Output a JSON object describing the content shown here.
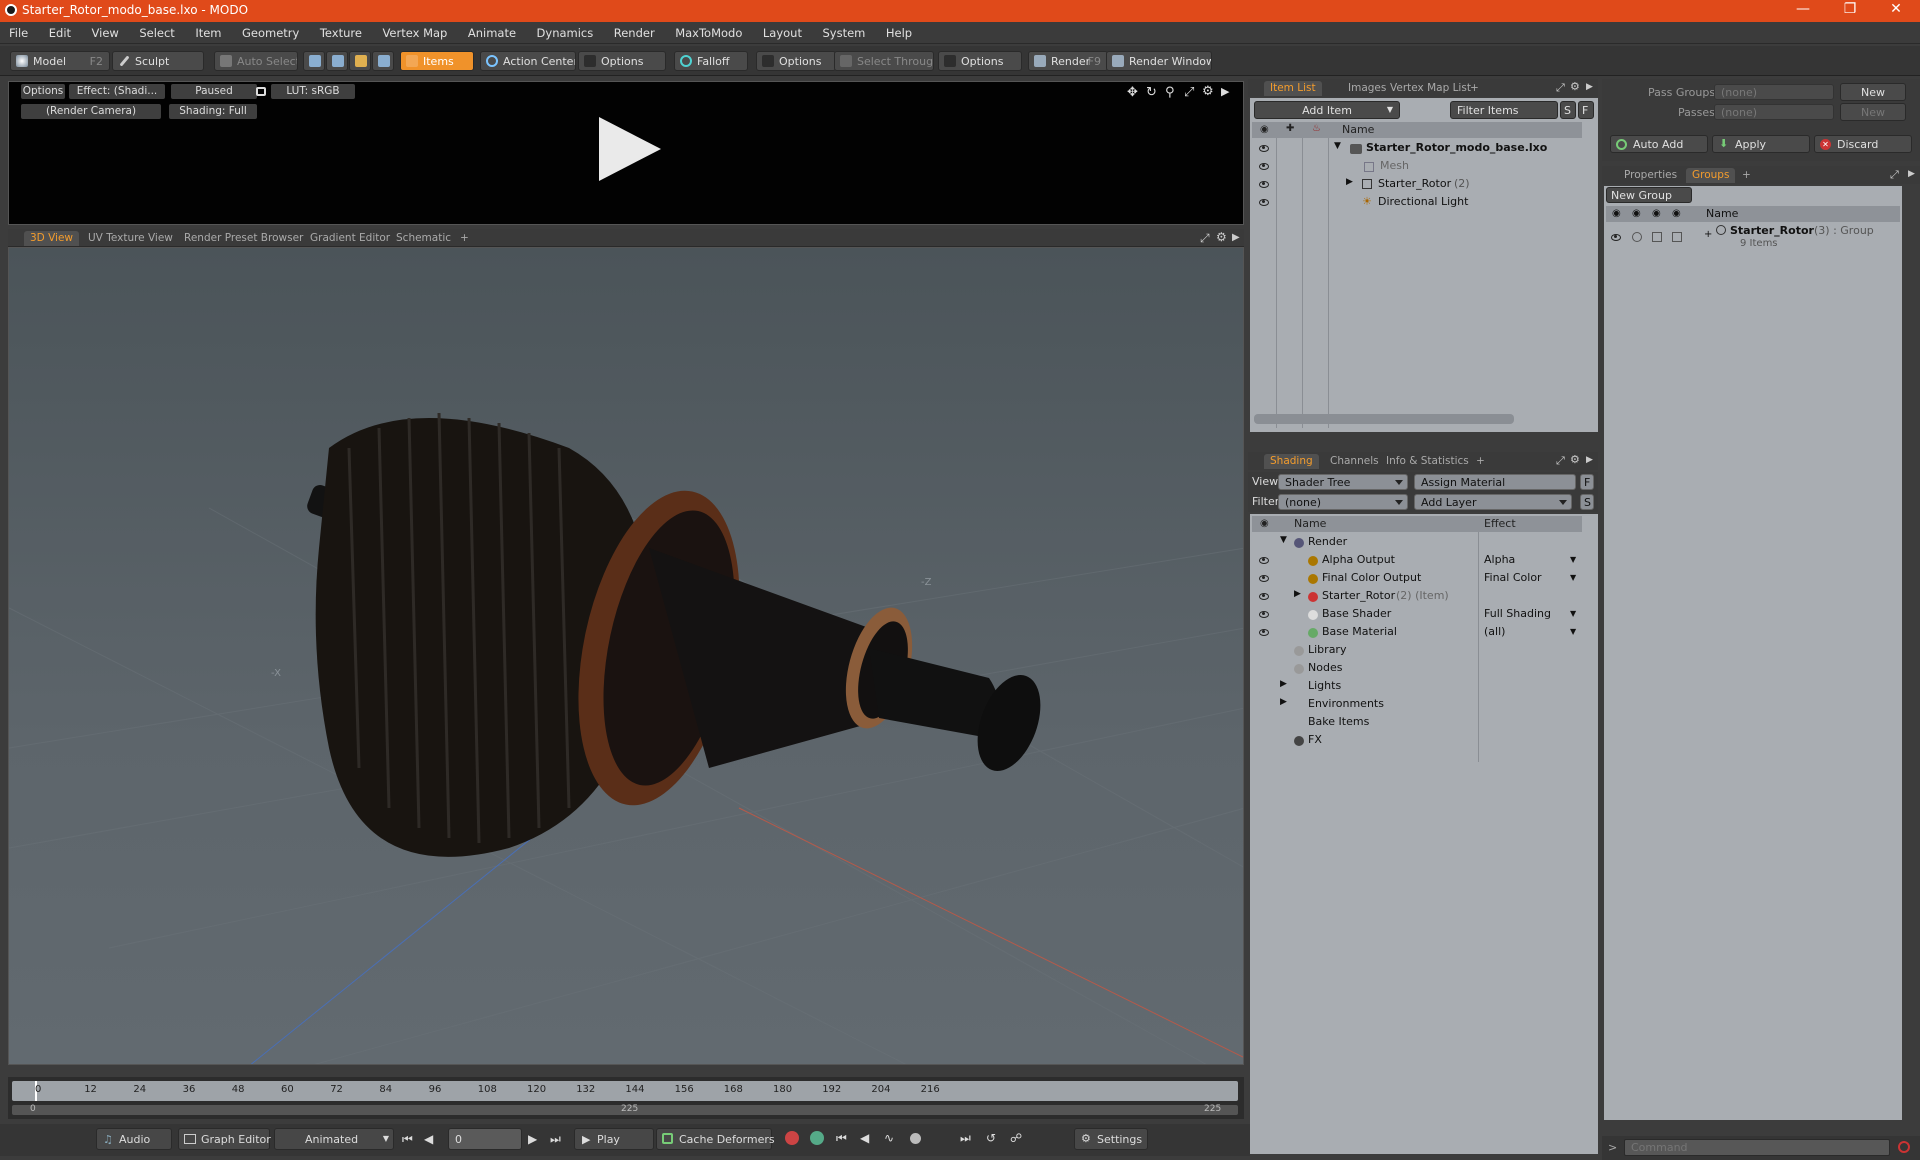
{
  "window": {
    "title": "Starter_Rotor_modo_base.lxo - MODO"
  },
  "menu": [
    "File",
    "Edit",
    "View",
    "Select",
    "Item",
    "Geometry",
    "Texture",
    "Vertex Map",
    "Animate",
    "Dynamics",
    "Render",
    "MaxToModo",
    "Layout",
    "System",
    "Help"
  ],
  "toolbar": {
    "model": "Model",
    "model_key": "F2",
    "sculpt": "Sculpt",
    "auto_select": "Auto Select",
    "items": "Items",
    "action_center": "Action Center",
    "options1": "Options",
    "falloff": "Falloff",
    "options2": "Options",
    "select_through": "Select Through",
    "options3": "Options",
    "render": "Render",
    "render_key": "F9",
    "render_window": "Render Window"
  },
  "preview": {
    "options": "Options",
    "effect": "Effect: (Shadi...",
    "paused": "Paused",
    "lut": "LUT: sRGB",
    "camera": "(Render Camera)",
    "shading": "Shading: Full"
  },
  "viewport_tabs": [
    "3D View",
    "UV Texture View",
    "Render Preset Browser",
    "Gradient Editor",
    "Schematic",
    "+"
  ],
  "viewport_axis_labels": {
    "z": "-Z",
    "x": "-X"
  },
  "timeline": {
    "ticks": [
      "0",
      "12",
      "24",
      "36",
      "48",
      "60",
      "72",
      "84",
      "96",
      "108",
      "120",
      "132",
      "144",
      "156",
      "168",
      "180",
      "192",
      "204",
      "216"
    ],
    "range_start": "0",
    "range_mid": "225",
    "range_end": "225"
  },
  "bottom": {
    "audio": "Audio",
    "graph_editor": "Graph Editor",
    "animated": "Animated",
    "frame": "0",
    "play": "Play",
    "cache_deformers": "Cache Deformers",
    "settings": "Settings"
  },
  "item_list": {
    "tabs": [
      "Item List",
      "Images",
      "Vertex Map List",
      "+"
    ],
    "add_item": "Add Item",
    "filter_items": "Filter Items",
    "s": "S",
    "f": "F",
    "col_name": "Name",
    "rows": [
      {
        "label": "Starter_Rotor_modo_base.lxo",
        "sub": ""
      },
      {
        "label": "Mesh",
        "sub": ""
      },
      {
        "label": "Starter_Rotor",
        "sub": "(2)"
      },
      {
        "label": "Directional Light",
        "sub": ""
      }
    ]
  },
  "shading": {
    "tabs": [
      "Shading",
      "Channels",
      "Info & Statistics",
      "+"
    ],
    "view_label": "View",
    "view_value": "Shader Tree",
    "assign_material": "Assign Material",
    "f": "F",
    "filter_label": "Filter",
    "filter_value": "(none)",
    "add_layer": "Add Layer",
    "s": "S",
    "col_name": "Name",
    "col_effect": "Effect",
    "rows": [
      {
        "label": "Render",
        "sub": "",
        "effect": ""
      },
      {
        "label": "Alpha Output",
        "sub": "",
        "effect": "Alpha"
      },
      {
        "label": "Final Color Output",
        "sub": "",
        "effect": "Final Color"
      },
      {
        "label": "Starter_Rotor",
        "sub": "(2) (Item)",
        "effect": ""
      },
      {
        "label": "Base Shader",
        "sub": "",
        "effect": "Full Shading"
      },
      {
        "label": "Base Material",
        "sub": "",
        "effect": "(all)"
      },
      {
        "label": "Library",
        "sub": "",
        "effect": ""
      },
      {
        "label": "Nodes",
        "sub": "",
        "effect": ""
      },
      {
        "label": "Lights",
        "sub": "",
        "effect": ""
      },
      {
        "label": "Environments",
        "sub": "",
        "effect": ""
      },
      {
        "label": "Bake Items",
        "sub": "",
        "effect": ""
      },
      {
        "label": "FX",
        "sub": "",
        "effect": ""
      }
    ]
  },
  "groups": {
    "pass_groups_label": "Pass Groups",
    "pass_groups_value": "(none)",
    "new": "New",
    "passes_label": "Passes",
    "passes_value": "(none)",
    "new2": "New",
    "auto_add": "Auto Add",
    "apply": "Apply",
    "discard": "Discard",
    "tabs": [
      "Properties",
      "Groups",
      "+"
    ],
    "new_group": "New Group",
    "col_name": "Name",
    "group_name": "Starter_Rotor",
    "group_sub": "(3) : Group",
    "group_items": "9 Items"
  },
  "command": {
    "placeholder": "Command"
  },
  "colors": {
    "accent": "#f39c2d",
    "titlebar": "#e04a1a",
    "panel": "#a9adb2"
  }
}
